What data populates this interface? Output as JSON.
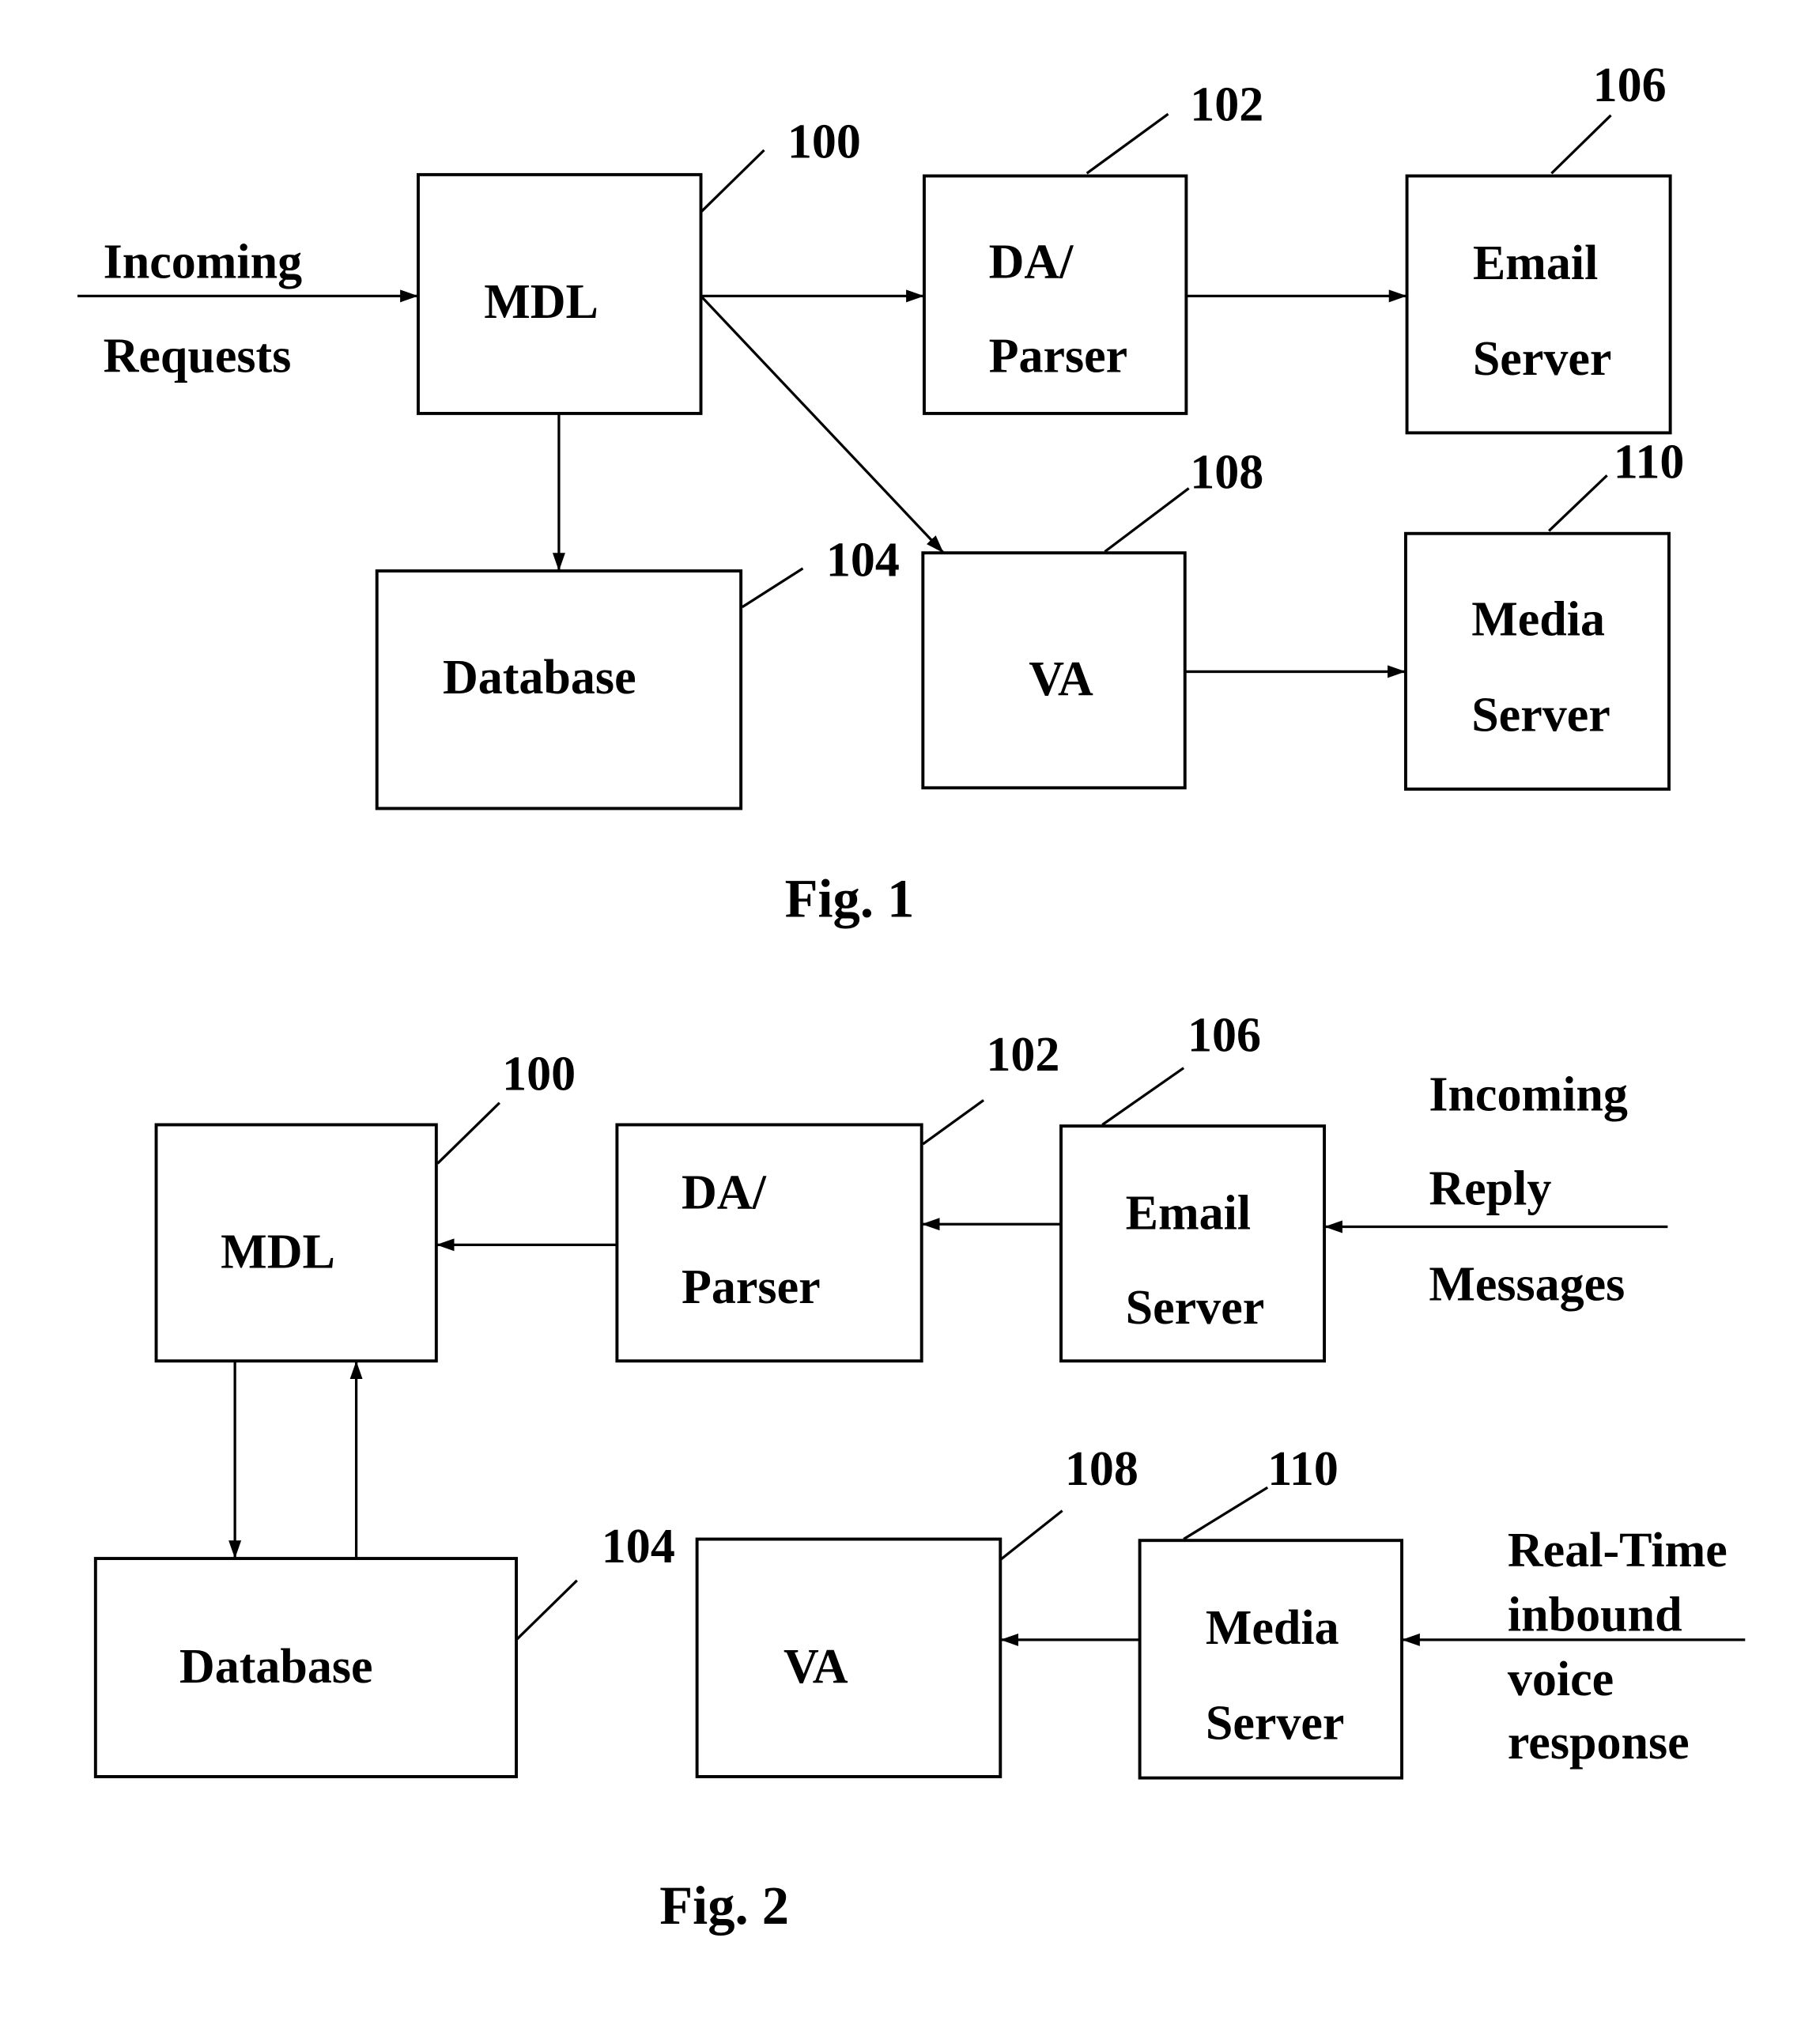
{
  "figures": [
    {
      "caption": "Fig. 1",
      "input_label": [
        "Incoming",
        "Requests"
      ],
      "blocks": {
        "mdl": {
          "ref": "100",
          "lines": [
            "MDL"
          ]
        },
        "parser": {
          "ref": "102",
          "lines": [
            "DA/",
            "Parser"
          ]
        },
        "database": {
          "ref": "104",
          "lines": [
            "Database"
          ]
        },
        "email": {
          "ref": "106",
          "lines": [
            "Email",
            "Server"
          ]
        },
        "va": {
          "ref": "108",
          "lines": [
            "VA"
          ]
        },
        "media": {
          "ref": "110",
          "lines": [
            "Media",
            "Server"
          ]
        }
      },
      "connections": [
        "Incoming Requests -> MDL",
        "MDL -> DA/Parser",
        "MDL -> VA",
        "MDL -> Database",
        "DA/Parser -> Email Server",
        "VA -> Media Server"
      ]
    },
    {
      "caption": "Fig. 2",
      "email_input_label": [
        "Incoming",
        "Reply",
        "Messages"
      ],
      "media_input_label": [
        "Real-Time",
        "inbound",
        "voice",
        "response"
      ],
      "blocks": {
        "mdl": {
          "ref": "100",
          "lines": [
            "MDL"
          ]
        },
        "parser": {
          "ref": "102",
          "lines": [
            "DA/",
            "Parser"
          ]
        },
        "database": {
          "ref": "104",
          "lines": [
            "Database"
          ]
        },
        "email": {
          "ref": "106",
          "lines": [
            "Email",
            "Server"
          ]
        },
        "va": {
          "ref": "108",
          "lines": [
            "VA"
          ]
        },
        "media": {
          "ref": "110",
          "lines": [
            "Media",
            "Server"
          ]
        }
      },
      "connections": [
        "Incoming Reply Messages -> Email Server",
        "Email Server -> DA/Parser",
        "DA/Parser -> MDL",
        "MDL -> Database",
        "Database -> MDL",
        "Real-Time inbound voice response -> Media Server",
        "Media Server -> VA"
      ]
    }
  ]
}
